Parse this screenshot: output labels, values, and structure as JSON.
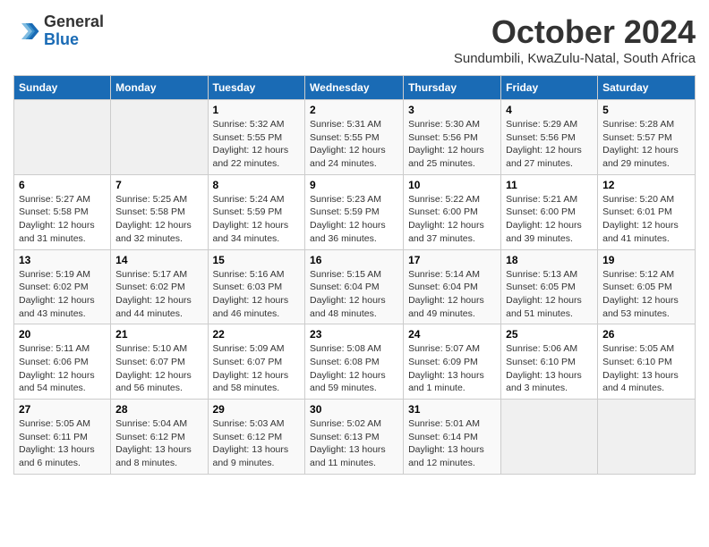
{
  "header": {
    "logo_line1": "General",
    "logo_line2": "Blue",
    "month": "October 2024",
    "location": "Sundumbili, KwaZulu-Natal, South Africa"
  },
  "days_of_week": [
    "Sunday",
    "Monday",
    "Tuesday",
    "Wednesday",
    "Thursday",
    "Friday",
    "Saturday"
  ],
  "weeks": [
    [
      {
        "num": "",
        "empty": true
      },
      {
        "num": "",
        "empty": true
      },
      {
        "num": "1",
        "sunrise": "5:32 AM",
        "sunset": "5:55 PM",
        "daylight": "12 hours and 22 minutes."
      },
      {
        "num": "2",
        "sunrise": "5:31 AM",
        "sunset": "5:55 PM",
        "daylight": "12 hours and 24 minutes."
      },
      {
        "num": "3",
        "sunrise": "5:30 AM",
        "sunset": "5:56 PM",
        "daylight": "12 hours and 25 minutes."
      },
      {
        "num": "4",
        "sunrise": "5:29 AM",
        "sunset": "5:56 PM",
        "daylight": "12 hours and 27 minutes."
      },
      {
        "num": "5",
        "sunrise": "5:28 AM",
        "sunset": "5:57 PM",
        "daylight": "12 hours and 29 minutes."
      }
    ],
    [
      {
        "num": "6",
        "sunrise": "5:27 AM",
        "sunset": "5:58 PM",
        "daylight": "12 hours and 31 minutes."
      },
      {
        "num": "7",
        "sunrise": "5:25 AM",
        "sunset": "5:58 PM",
        "daylight": "12 hours and 32 minutes."
      },
      {
        "num": "8",
        "sunrise": "5:24 AM",
        "sunset": "5:59 PM",
        "daylight": "12 hours and 34 minutes."
      },
      {
        "num": "9",
        "sunrise": "5:23 AM",
        "sunset": "5:59 PM",
        "daylight": "12 hours and 36 minutes."
      },
      {
        "num": "10",
        "sunrise": "5:22 AM",
        "sunset": "6:00 PM",
        "daylight": "12 hours and 37 minutes."
      },
      {
        "num": "11",
        "sunrise": "5:21 AM",
        "sunset": "6:00 PM",
        "daylight": "12 hours and 39 minutes."
      },
      {
        "num": "12",
        "sunrise": "5:20 AM",
        "sunset": "6:01 PM",
        "daylight": "12 hours and 41 minutes."
      }
    ],
    [
      {
        "num": "13",
        "sunrise": "5:19 AM",
        "sunset": "6:02 PM",
        "daylight": "12 hours and 43 minutes."
      },
      {
        "num": "14",
        "sunrise": "5:17 AM",
        "sunset": "6:02 PM",
        "daylight": "12 hours and 44 minutes."
      },
      {
        "num": "15",
        "sunrise": "5:16 AM",
        "sunset": "6:03 PM",
        "daylight": "12 hours and 46 minutes."
      },
      {
        "num": "16",
        "sunrise": "5:15 AM",
        "sunset": "6:04 PM",
        "daylight": "12 hours and 48 minutes."
      },
      {
        "num": "17",
        "sunrise": "5:14 AM",
        "sunset": "6:04 PM",
        "daylight": "12 hours and 49 minutes."
      },
      {
        "num": "18",
        "sunrise": "5:13 AM",
        "sunset": "6:05 PM",
        "daylight": "12 hours and 51 minutes."
      },
      {
        "num": "19",
        "sunrise": "5:12 AM",
        "sunset": "6:05 PM",
        "daylight": "12 hours and 53 minutes."
      }
    ],
    [
      {
        "num": "20",
        "sunrise": "5:11 AM",
        "sunset": "6:06 PM",
        "daylight": "12 hours and 54 minutes."
      },
      {
        "num": "21",
        "sunrise": "5:10 AM",
        "sunset": "6:07 PM",
        "daylight": "12 hours and 56 minutes."
      },
      {
        "num": "22",
        "sunrise": "5:09 AM",
        "sunset": "6:07 PM",
        "daylight": "12 hours and 58 minutes."
      },
      {
        "num": "23",
        "sunrise": "5:08 AM",
        "sunset": "6:08 PM",
        "daylight": "12 hours and 59 minutes."
      },
      {
        "num": "24",
        "sunrise": "5:07 AM",
        "sunset": "6:09 PM",
        "daylight": "13 hours and 1 minute."
      },
      {
        "num": "25",
        "sunrise": "5:06 AM",
        "sunset": "6:10 PM",
        "daylight": "13 hours and 3 minutes."
      },
      {
        "num": "26",
        "sunrise": "5:05 AM",
        "sunset": "6:10 PM",
        "daylight": "13 hours and 4 minutes."
      }
    ],
    [
      {
        "num": "27",
        "sunrise": "5:05 AM",
        "sunset": "6:11 PM",
        "daylight": "13 hours and 6 minutes."
      },
      {
        "num": "28",
        "sunrise": "5:04 AM",
        "sunset": "6:12 PM",
        "daylight": "13 hours and 8 minutes."
      },
      {
        "num": "29",
        "sunrise": "5:03 AM",
        "sunset": "6:12 PM",
        "daylight": "13 hours and 9 minutes."
      },
      {
        "num": "30",
        "sunrise": "5:02 AM",
        "sunset": "6:13 PM",
        "daylight": "13 hours and 11 minutes."
      },
      {
        "num": "31",
        "sunrise": "5:01 AM",
        "sunset": "6:14 PM",
        "daylight": "13 hours and 12 minutes."
      },
      {
        "num": "",
        "empty": true
      },
      {
        "num": "",
        "empty": true
      }
    ]
  ]
}
